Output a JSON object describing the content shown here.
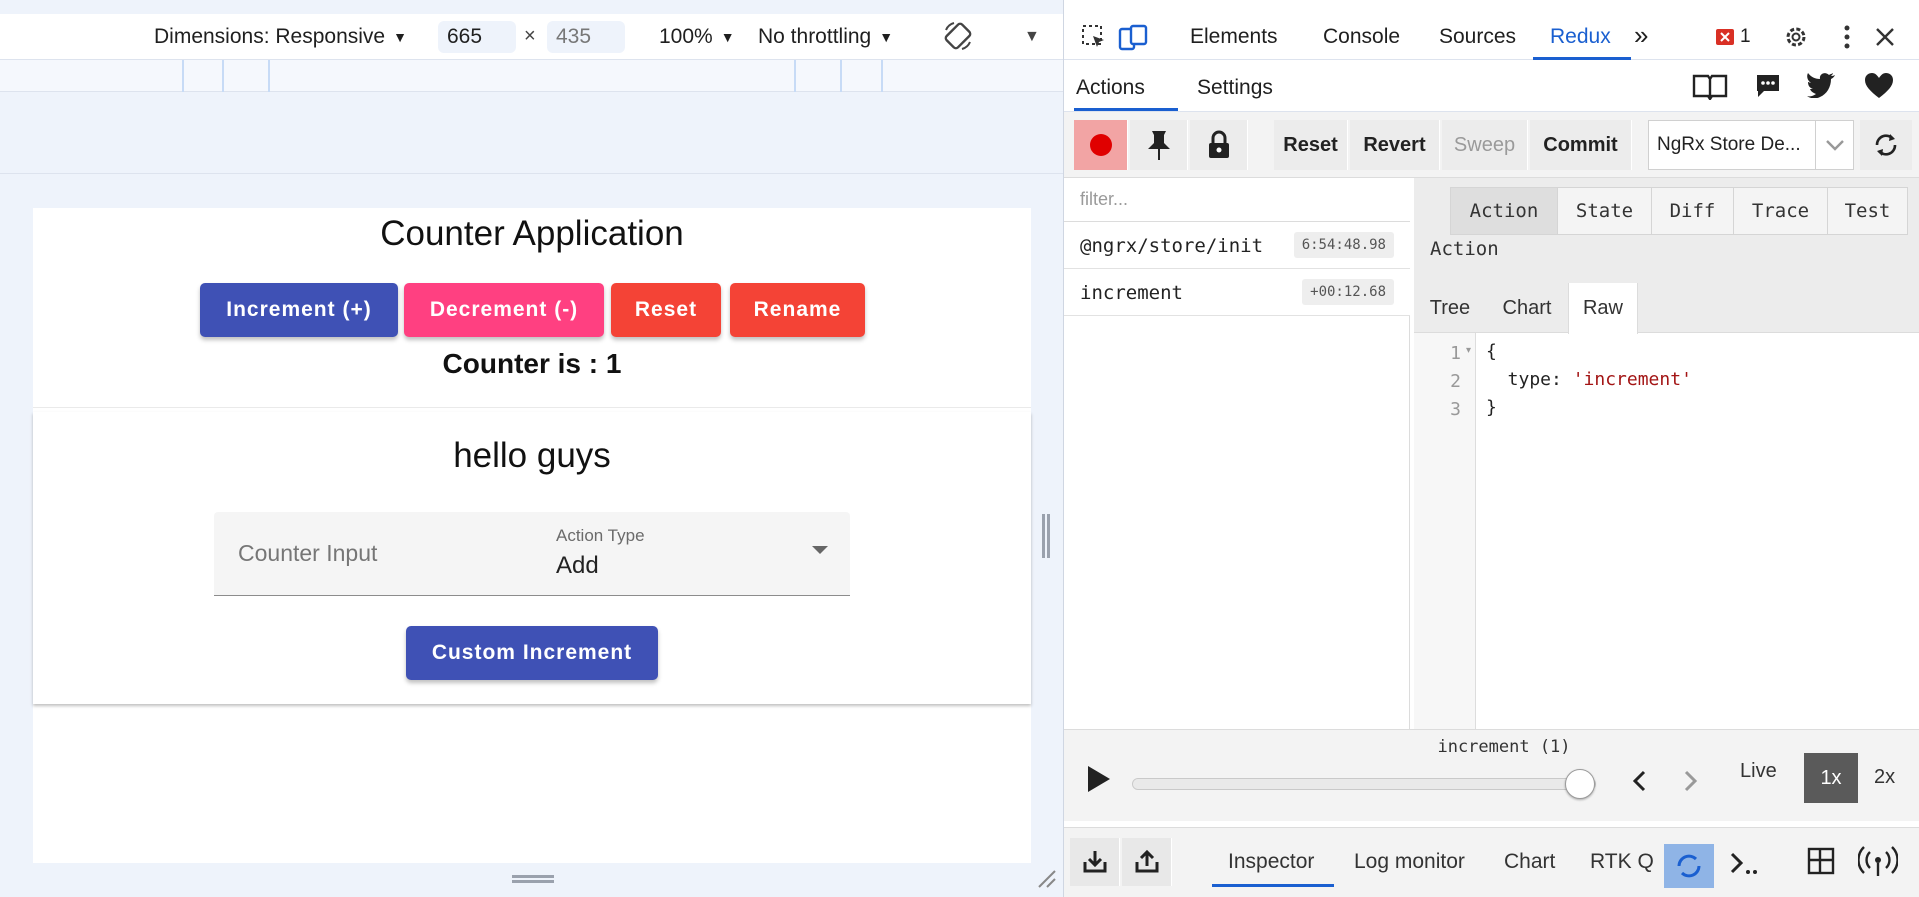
{
  "device_toolbar": {
    "dimensions_label": "Dimensions: Responsive",
    "width_value": "665",
    "height_placeholder": "435",
    "times": "×",
    "zoom": "100%",
    "throttling": "No throttling"
  },
  "app": {
    "card1": {
      "title": "Counter Application",
      "buttons": [
        {
          "label": "Increment (+)",
          "color": "#3f51b5"
        },
        {
          "label": "Decrement (-)",
          "color": "#ff4081"
        },
        {
          "label": "Reset",
          "color": "#f44336"
        },
        {
          "label": "Rename",
          "color": "#f44336"
        }
      ],
      "counter_text": "Counter is : 1"
    },
    "card2": {
      "title": "hello guys",
      "counter_input_placeholder": "Counter Input",
      "action_type_label": "Action Type",
      "action_type_value": "Add",
      "custom_button": "Custom Increment"
    }
  },
  "devtools": {
    "tabs": [
      "Elements",
      "Console",
      "Sources",
      "Redux"
    ],
    "active_tab": "Redux",
    "more": "»",
    "error_count": "1",
    "accent": "#1a5fd0"
  },
  "redux": {
    "subtabs": {
      "actions": "Actions",
      "settings": "Settings"
    },
    "toolbar": {
      "reset": "Reset",
      "revert": "Revert",
      "sweep": "Sweep",
      "commit": "Commit",
      "store": "NgRx Store De..."
    },
    "filter_placeholder": "filter...",
    "actions": [
      {
        "name": "@ngrx/store/init",
        "time": "6:54:48.98"
      },
      {
        "name": "increment",
        "time": "+00:12.68"
      }
    ],
    "detail_tabs": [
      "Action",
      "State",
      "Diff",
      "Trace",
      "Test"
    ],
    "detail_heading": "Action",
    "view_tabs": [
      "Tree",
      "Chart",
      "Raw"
    ],
    "code": {
      "line_numbers": [
        "1",
        "2",
        "3"
      ],
      "line1": "{",
      "line2_key": "  type: ",
      "line2_value": "'increment'",
      "line3": "}"
    },
    "slider": {
      "label": "increment (1)",
      "position": 1.0,
      "live": "Live",
      "speed_1x": "1x",
      "speed_2x": "2x"
    },
    "monitor_tabs": [
      "Inspector",
      "Log monitor",
      "Chart",
      "RTK Q"
    ]
  }
}
